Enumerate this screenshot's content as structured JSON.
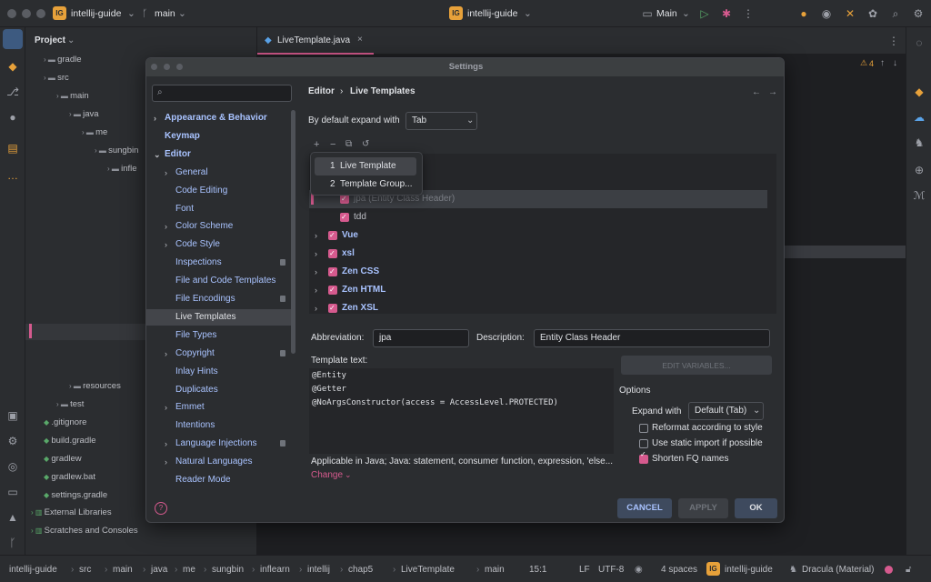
{
  "window": {
    "project": "intellij-guide",
    "project_badge": "IG",
    "branch": "main",
    "run_config": "Main"
  },
  "project_panel": {
    "title": "Project",
    "rows": [
      {
        "label": "gradle",
        "indent": 1,
        "icon": "folder"
      },
      {
        "label": "src",
        "indent": 1,
        "icon": "folder"
      },
      {
        "label": "main",
        "indent": 2,
        "icon": "folder"
      },
      {
        "label": "java",
        "indent": 3,
        "icon": "folder"
      },
      {
        "label": "me",
        "indent": 4,
        "icon": "folder"
      },
      {
        "label": "sungbin",
        "indent": 5,
        "icon": "folder"
      },
      {
        "label": "infle",
        "indent": 6,
        "icon": "folder"
      },
      {
        "label": "resources",
        "indent": 3,
        "icon": "folder"
      },
      {
        "label": "test",
        "indent": 2,
        "icon": "folder"
      },
      {
        "label": ".gitignore",
        "indent": 1,
        "icon": "file"
      },
      {
        "label": "build.gradle",
        "indent": 1,
        "icon": "file"
      },
      {
        "label": "gradlew",
        "indent": 1,
        "icon": "file"
      },
      {
        "label": "gradlew.bat",
        "indent": 1,
        "icon": "file"
      },
      {
        "label": "settings.gradle",
        "indent": 1,
        "icon": "file"
      },
      {
        "label": "External Libraries",
        "indent": 0,
        "icon": "lib"
      },
      {
        "label": "Scratches and Consoles",
        "indent": 0,
        "icon": "scratch"
      }
    ]
  },
  "editor": {
    "tab": "LiveTemplate.java",
    "warnings": "4"
  },
  "dialog": {
    "title": "Settings",
    "search_placeholder": "",
    "breadcrumb": {
      "parent": "Editor",
      "sep": "›",
      "current": "Live Templates"
    },
    "nav": [
      {
        "label": "Appearance & Behavior",
        "chev": "›",
        "bold": true
      },
      {
        "label": "Keymap",
        "bold": true
      },
      {
        "label": "Editor",
        "chev": "⌄",
        "bold": true
      },
      {
        "label": "General",
        "chev": "›"
      },
      {
        "label": "Code Editing"
      },
      {
        "label": "Font"
      },
      {
        "label": "Color Scheme",
        "chev": "›"
      },
      {
        "label": "Code Style",
        "chev": "›"
      },
      {
        "label": "Inspections",
        "badge": true
      },
      {
        "label": "File and Code Templates"
      },
      {
        "label": "File Encodings",
        "badge": true
      },
      {
        "label": "Live Templates",
        "selected": true
      },
      {
        "label": "File Types"
      },
      {
        "label": "Copyright",
        "chev": "›",
        "badge": true
      },
      {
        "label": "Inlay Hints"
      },
      {
        "label": "Duplicates"
      },
      {
        "label": "Emmet",
        "chev": "›"
      },
      {
        "label": "Intentions"
      },
      {
        "label": "Language Injections",
        "chev": "›",
        "badge": true
      },
      {
        "label": "Natural Languages",
        "chev": "›"
      },
      {
        "label": "Reader Mode"
      }
    ],
    "expand_label": "By default expand with",
    "expand_value": "Tab",
    "popup": [
      {
        "num": "1",
        "label": "Live Template"
      },
      {
        "num": "2",
        "label": "Template Group..."
      }
    ],
    "tree": [
      {
        "label": "jpa (Entity Class Header)",
        "child": true,
        "selected": true
      },
      {
        "label": "tdd",
        "child": true
      },
      {
        "label": "Vue",
        "group": true
      },
      {
        "label": "xsl",
        "group": true
      },
      {
        "label": "Zen CSS",
        "group": true
      },
      {
        "label": "Zen HTML",
        "group": true
      },
      {
        "label": "Zen XSL",
        "group": true
      }
    ],
    "abbr_label": "Abbreviation:",
    "abbr_value": "jpa",
    "desc_label": "Description:",
    "desc_value": "Entity Class Header",
    "template_label": "Template text:",
    "template_lines": [
      "@Entity",
      "@Getter",
      "@NoArgsConstructor(access = AccessLevel.PROTECTED)"
    ],
    "edit_vars": "EDIT VARIABLES...",
    "options_label": "Options",
    "expand_with_label": "Expand with",
    "expand_with_value": "Default (Tab)",
    "checks": [
      {
        "label": "Reformat according to style",
        "checked": false
      },
      {
        "label": "Use static import if possible",
        "checked": false
      },
      {
        "label": "Shorten FQ names",
        "checked": true
      }
    ],
    "applicable": "Applicable in Java; Java: statement, consumer function, expression, 'else...",
    "change": "Change",
    "cancel": "CANCEL",
    "apply": "APPLY",
    "ok": "OK",
    "help": "?"
  },
  "statusbar": {
    "crumbs": [
      "intellij-guide",
      "src",
      "main",
      "java",
      "me",
      "sungbin",
      "inflearn",
      "intellij",
      "chap5",
      "LiveTemplate",
      "main"
    ],
    "position": "15:1",
    "line_sep": "LF",
    "encoding": "UTF-8",
    "indent": "4 spaces",
    "project": "intellij-guide",
    "theme": "Dracula (Material)"
  },
  "colors": {
    "accent": "#d65a8e",
    "link": "#a9c3ff",
    "badge": "#e7a13a"
  }
}
